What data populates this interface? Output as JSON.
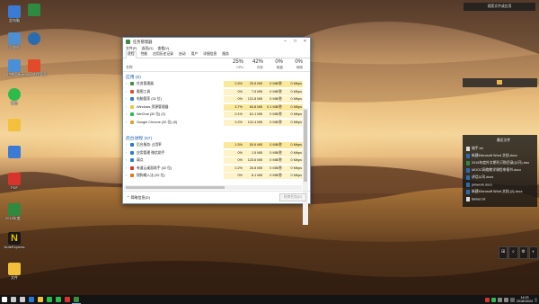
{
  "colors": {
    "accent": "#1a5fa8",
    "cpu_highlight": "#fdf3c6",
    "cpu_highlight_strong": "#fbe89a"
  },
  "desktop_icons": [
    {
      "label": "此电脑",
      "color": "#3a7bd5",
      "icon": "computer-icon"
    },
    {
      "label": "",
      "color": "#2d8a3e",
      "icon": "excel-icon"
    },
    {
      "label": "回收站",
      "color": "#4d8fd0",
      "icon": "recycle-bin-icon"
    },
    {
      "label": "",
      "color": "#2b6cb0",
      "icon": "browser-icon"
    },
    {
      "label": "控制面板",
      "color": "#4a90d9",
      "icon": "control-panel-icon"
    },
    {
      "label": "ad8s8 软件管家",
      "color": "#e24a2b",
      "icon": "app-icon"
    },
    {
      "label": "微信",
      "color": "#2dbb4b",
      "icon": "wechat-icon"
    },
    {
      "label": "",
      "color": "#f2c03a",
      "icon": "folder-icon"
    },
    {
      "label": "PDF",
      "color": "#d9342b",
      "icon": "pdf-icon"
    },
    {
      "label": "2018年度...",
      "color": "#2d8a3e",
      "icon": "excel-file-icon"
    },
    {
      "label": "NoteExpress",
      "color": "#f2c400",
      "icon": "noteexpress-icon"
    },
    {
      "label": "文件",
      "color": "#f2c03a",
      "icon": "folder-icon"
    }
  ],
  "task_manager": {
    "title": "任务管理器",
    "menu": [
      "文件(F)",
      "选项(O)",
      "查看(V)"
    ],
    "tabs": [
      "进程",
      "性能",
      "应用历史记录",
      "启动",
      "用户",
      "详细信息",
      "服务"
    ],
    "name_header": "名称",
    "columns": [
      {
        "pct": "25%",
        "label": "CPU"
      },
      {
        "pct": "42%",
        "label": "内存"
      },
      {
        "pct": "0%",
        "label": "磁盘"
      },
      {
        "pct": "0%",
        "label": "网络"
      }
    ],
    "apps_group": "应用 (6)",
    "apps": [
      {
        "name": "任务管理器",
        "cpu": "2.5%",
        "mem": "25.5 MB",
        "disk": "0 MB/秒",
        "net": "0 Mbps",
        "color": "#3c8d3c"
      },
      {
        "name": "截图工具",
        "cpu": "0%",
        "mem": "7.5 MB",
        "disk": "0 MB/秒",
        "net": "0 Mbps",
        "color": "#d94f2b"
      },
      {
        "name": "电脑管家 (32 位)",
        "cpu": "0%",
        "mem": "131.8 MB",
        "disk": "0 MB/秒",
        "net": "0 Mbps",
        "color": "#2b78d4"
      },
      {
        "name": "Windows 资源管理器",
        "cpu": "3.7%",
        "mem": "84.8 MB",
        "disk": "0.1 MB/秒",
        "net": "0 Mbps",
        "color": "#f2c03a"
      },
      {
        "name": "WeChat (32 位) (2)",
        "cpu": "0.1%",
        "mem": "61.1 MB",
        "disk": "0 MB/秒",
        "net": "0 Mbps",
        "color": "#2dbb4b"
      },
      {
        "name": "Google Chrome (32 位) (5)",
        "cpu": "0.2%",
        "mem": "131.4 MB",
        "disk": "0 MB/秒",
        "net": "0 Mbps",
        "color": "#e0a030"
      }
    ],
    "bg_group": "后台进程 (67)",
    "bg": [
      {
        "name": "后台服务·占用率",
        "cpu": "1.5%",
        "mem": "50.6 MB",
        "disk": "0 MB/秒",
        "net": "0 Mbps",
        "color": "#2b78d4"
      },
      {
        "name": "应用管理 微信助手",
        "cpu": "0%",
        "mem": "1.5 MB",
        "disk": "0 MB/秒",
        "net": "0 Mbps",
        "color": "#2b78d4"
      },
      {
        "name": "弱点",
        "cpu": "0%",
        "mem": "123.6 MB",
        "disk": "0 MB/秒",
        "net": "0 Mbps",
        "color": "#2b78d4"
      },
      {
        "name": "有道云桌面助手 (32 位)",
        "cpu": "0.2%",
        "mem": "26.8 MB",
        "disk": "0 MB/秒",
        "net": "0 Mbps",
        "color": "#d9342b"
      },
      {
        "name": "搜狗输入法 (32 位)",
        "cpu": "0%",
        "mem": "8.1 MB",
        "disk": "0 MB/秒",
        "net": "0 Mbps",
        "color": "#e07a1a"
      }
    ],
    "fewer_details": "简略信息(D)",
    "end_task": "结束任务(E)"
  },
  "right_widgets": {
    "search_text": "搜索文件或应用",
    "recent_title": "最近文件",
    "recent_files": [
      {
        "name": "随手.txt",
        "color": "#dddddd"
      },
      {
        "name": "新建Microsoft Word 文档.docx",
        "color": "#2b6cb0"
      },
      {
        "name": "2018年度外文期刊订购目录(公开).xlsx",
        "color": "#2d8a3e"
      },
      {
        "name": "MOOC网络教学课程申报书.docx",
        "color": "#2b6cb0"
      },
      {
        "name": "讲话公司.docx",
        "color": "#2b6cb0"
      },
      {
        "name": "joinwork.docx",
        "color": "#2b6cb0"
      },
      {
        "name": "新建Microsoft Word 文档 (2).docx",
        "color": "#2b6cb0"
      },
      {
        "name": "fanker.txt",
        "color": "#dddddd"
      }
    ],
    "tray_buttons": [
      "⊞",
      "⌕",
      "⚙",
      "◐"
    ]
  },
  "taskbar": {
    "items": [
      {
        "icon": "windows-start-icon",
        "color": "#ffffff"
      },
      {
        "icon": "search-icon",
        "color": "#cccccc"
      },
      {
        "icon": "task-view-icon",
        "color": "#cccccc"
      },
      {
        "icon": "browser-icon",
        "color": "#2b78d4"
      },
      {
        "icon": "file-explorer-icon",
        "color": "#f2c03a"
      },
      {
        "icon": "wechat-icon",
        "color": "#2dbb4b"
      },
      {
        "icon": "chat-icon",
        "color": "#2dbb4b"
      },
      {
        "icon": "office-icon",
        "color": "#d9342b"
      },
      {
        "icon": "task-manager-icon",
        "color": "#3c8d3c"
      }
    ],
    "time": "14:23",
    "date": "2018/10/24"
  }
}
